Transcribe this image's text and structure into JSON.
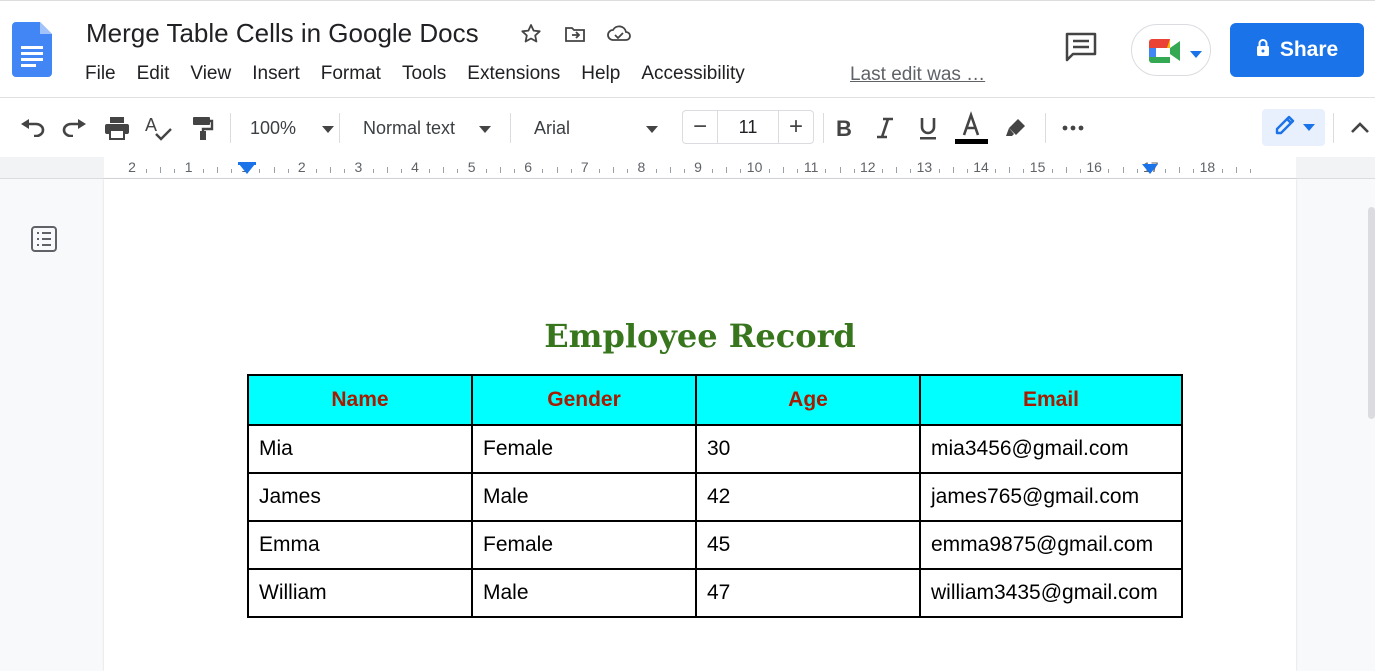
{
  "app": {
    "doc_title": "Merge Table Cells in Google Docs",
    "last_edit": "Last edit was …",
    "share_label": "Share"
  },
  "menu": [
    "File",
    "Edit",
    "View",
    "Insert",
    "Format",
    "Tools",
    "Extensions",
    "Help",
    "Accessibility"
  ],
  "toolbar": {
    "zoom": "100%",
    "style": "Normal text",
    "font": "Arial",
    "font_size": "11",
    "minus": "−",
    "plus": "+"
  },
  "ruler": {
    "labels": [
      "2",
      "1",
      "1",
      "2",
      "3",
      "4",
      "5",
      "6",
      "7",
      "8",
      "9",
      "10",
      "11",
      "12",
      "13",
      "14",
      "15",
      "16",
      "17",
      "18"
    ]
  },
  "document": {
    "heading": "Employee Record",
    "table": {
      "headers": [
        "Name",
        "Gender",
        "Age",
        "Email"
      ],
      "rows": [
        [
          "Mia",
          "Female",
          "30",
          "mia3456@gmail.com"
        ],
        [
          "James",
          "Male",
          "42",
          "james765@gmail.com"
        ],
        [
          "Emma",
          "Female",
          "45",
          "emma9875@gmail.com"
        ],
        [
          "William",
          "Male",
          "47",
          "william3435@gmail.com"
        ]
      ]
    }
  },
  "colors": {
    "accent": "#1a73e8",
    "heading": "#38761d",
    "header_bg": "#00ffff",
    "header_text": "#a61c00"
  },
  "icons": [
    "docs-logo-icon",
    "star-icon",
    "move-folder-icon",
    "cloud-saved-icon",
    "comment-icon",
    "meet-icon",
    "lock-icon",
    "undo-icon",
    "redo-icon",
    "print-icon",
    "spellcheck-icon",
    "paint-format-icon",
    "bold-icon",
    "italic-icon",
    "underline-icon",
    "text-color-icon",
    "highlight-icon",
    "more-icon",
    "edit-mode-icon",
    "collapse-icon",
    "outline-icon"
  ]
}
